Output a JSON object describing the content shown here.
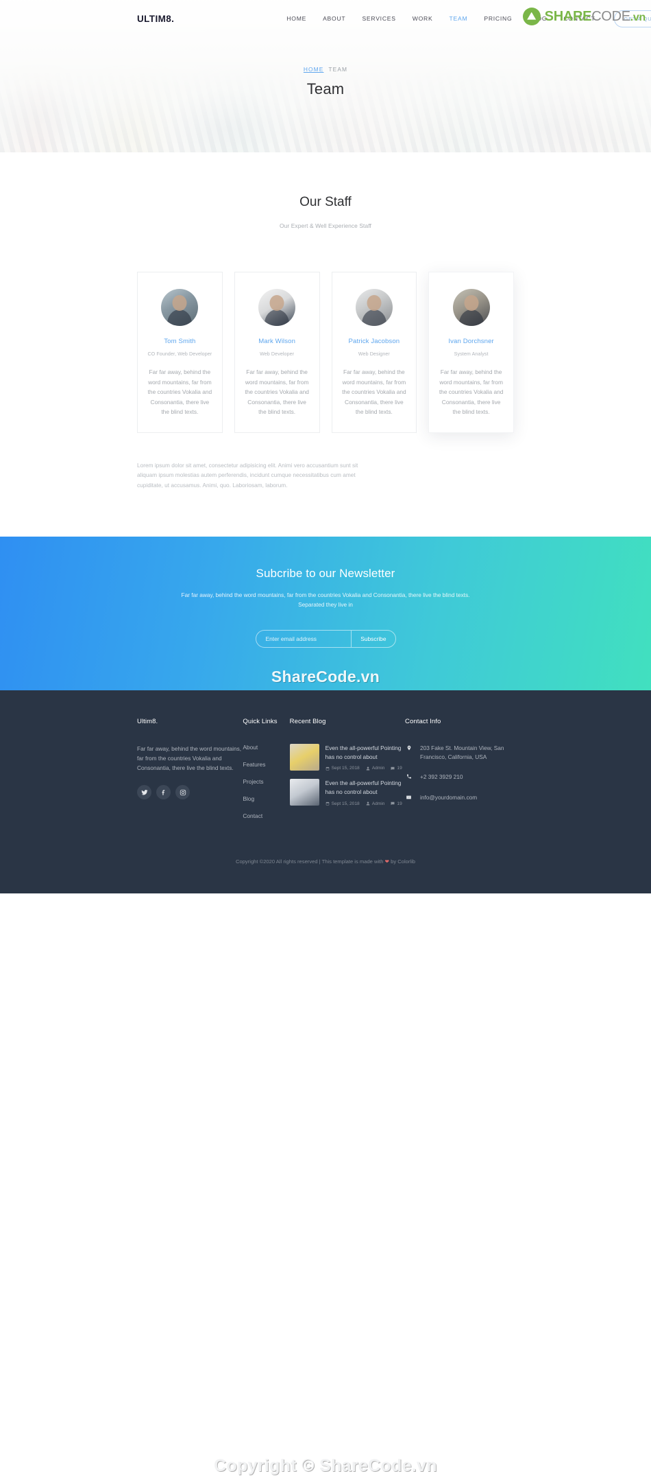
{
  "navbar": {
    "brand": "ULTIM8.",
    "links": [
      {
        "label": "HOME",
        "active": false
      },
      {
        "label": "ABOUT",
        "active": false
      },
      {
        "label": "SERVICES",
        "active": false
      },
      {
        "label": "WORK",
        "active": false
      },
      {
        "label": "TEAM",
        "active": true
      },
      {
        "label": "PRICING",
        "active": false
      },
      {
        "label": "BLOG",
        "active": false
      },
      {
        "label": "CONTACT",
        "active": false
      }
    ],
    "quote_button": "GET A QUOTE"
  },
  "watermark_logo": {
    "share": "SHARE",
    "code": "CODE",
    "vn": ".vn"
  },
  "hero": {
    "breadcrumb_home": "HOME",
    "breadcrumb_current": "TEAM",
    "title": "Team"
  },
  "staff": {
    "title": "Our Staff",
    "subtitle": "Our Expert & Well Experience Staff",
    "members": [
      {
        "name": "Tom Smith",
        "role": "CO Founder, Web Developer",
        "bio": "Far far away, behind the word mountains, far from the countries Vokalia and Consonantia, there live the blind texts."
      },
      {
        "name": "Mark Wilson",
        "role": "Web Developer",
        "bio": "Far far away, behind the word mountains, far from the countries Vokalia and Consonantia, there live the blind texts."
      },
      {
        "name": "Patrick Jacobson",
        "role": "Web Designer",
        "bio": "Far far away, behind the word mountains, far from the countries Vokalia and Consonantia, there live the blind texts."
      },
      {
        "name": "Ivan Dorchsner",
        "role": "System Analyst",
        "bio": "Far far away, behind the word mountains, far from the countries Vokalia and Consonantia, there live the blind texts."
      }
    ],
    "lorem": "Lorem ipsum dolor sit amet, consectetur adipisicing elit. Animi vero accusantium sunt sit aliquam ipsum molestias autem perferendis, incidunt cumque necessitatibus cum amet cupiditate, ut accusamus. Animi, quo. Laboriosam, laborum."
  },
  "newsletter": {
    "title": "Subcribe to our Newsletter",
    "subtitle": "Far far away, behind the word mountains, far from the countries Vokalia and Consonantia, there live the blind texts. Separated they live in",
    "placeholder": "Enter email address",
    "button": "Subscribe",
    "watermark": "ShareCode.vn"
  },
  "footer": {
    "brand": {
      "title": "Ultim8.",
      "text": "Far far away, behind the word mountains, far from the countries Vokalia and Consonantia, there live the blind texts.",
      "socials": [
        "twitter-icon",
        "facebook-icon",
        "instagram-icon"
      ]
    },
    "quick_links": {
      "title": "Quick Links",
      "items": [
        "About",
        "Features",
        "Projects",
        "Blog",
        "Contact"
      ]
    },
    "recent_blog": {
      "title": "Recent Blog",
      "posts": [
        {
          "title": "Even the all-powerful Pointing has no control about",
          "date": "Sept 15, 2018",
          "author": "Admin",
          "comments": "19"
        },
        {
          "title": "Even the all-powerful Pointing has no control about",
          "date": "Sept 15, 2018",
          "author": "Admin",
          "comments": "19"
        }
      ]
    },
    "contact": {
      "title": "Contact Info",
      "address": "203 Fake St. Mountain View, San Francisco, California, USA",
      "phone": "+2 392 3929 210",
      "email": "info@yourdomain.com"
    },
    "copyright_prefix": "Copyright ©2020 All rights reserved | This template is made with ",
    "copyright_suffix": " by Colorlib",
    "watermark": "Copyright © ShareCode.vn"
  },
  "colors": {
    "accent_blue": "#5ea6ee",
    "gradient_start": "#2f8ff2",
    "gradient_end": "#41e0bf",
    "footer_bg": "#2a3545",
    "logo_green": "#7ab648"
  }
}
